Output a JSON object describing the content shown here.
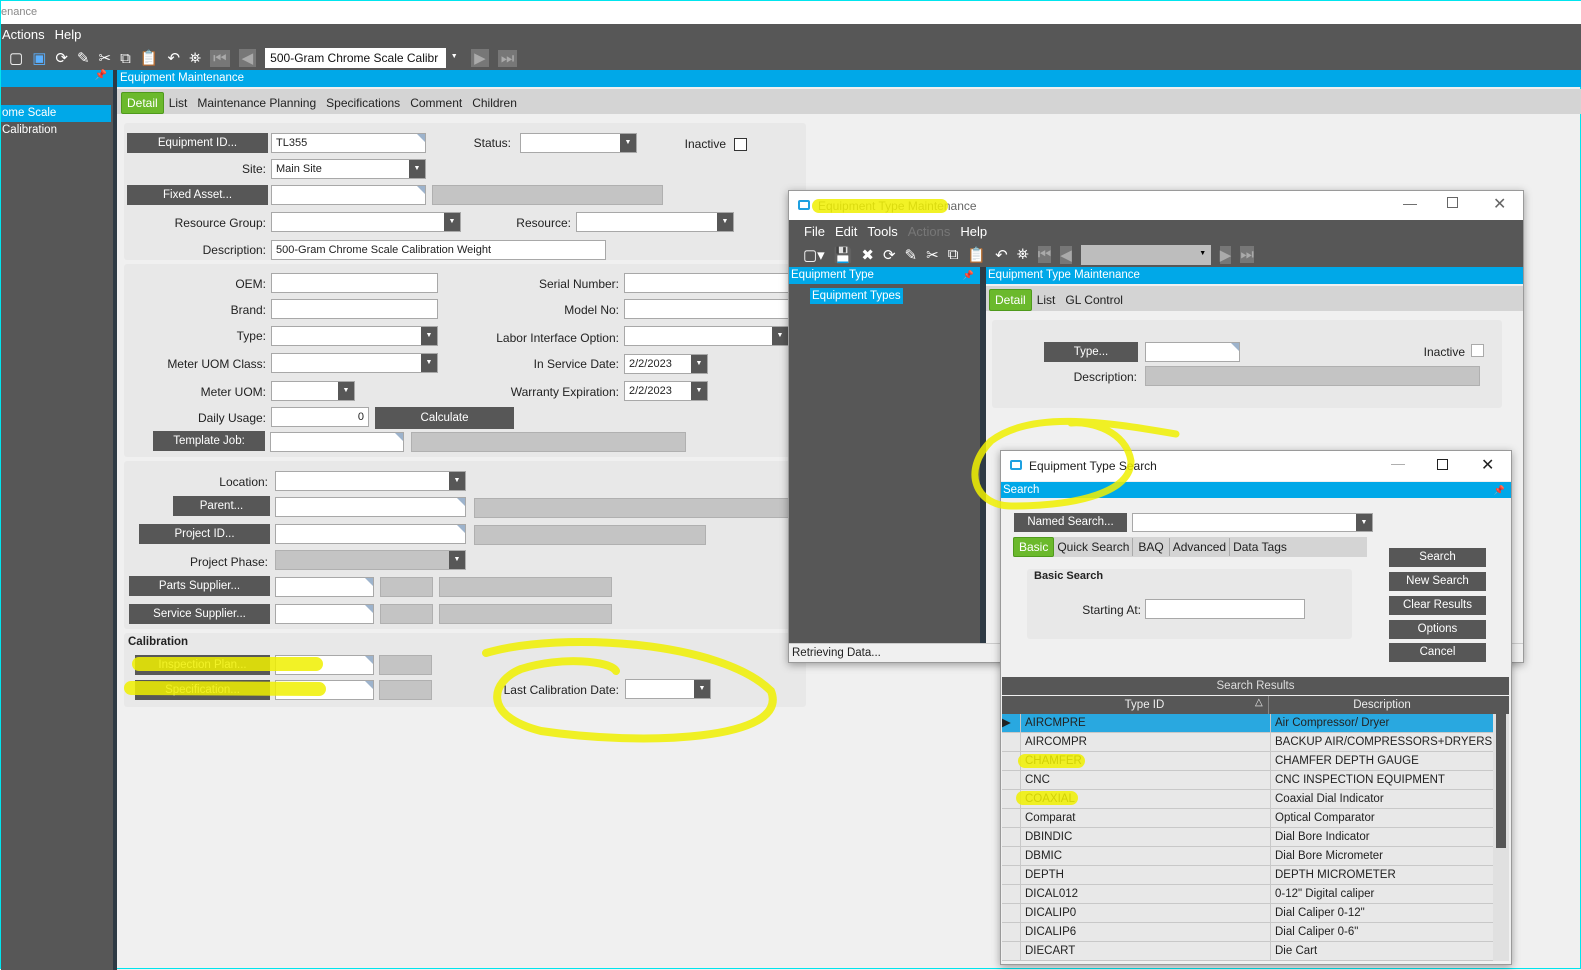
{
  "main": {
    "title": "enance",
    "menu": [
      "Actions",
      "Help"
    ],
    "nav_value": "500-Gram Chrome Scale Calibr",
    "panel_title": "Equipment Maintenance",
    "tree_item": "ome Scale Calibration",
    "tabs": [
      "Detail",
      "List",
      "Maintenance Planning",
      "Specifications",
      "Comment",
      "Children"
    ],
    "form": {
      "equipment_id_btn": "Equipment ID...",
      "equipment_id": "TL355",
      "status_lbl": "Status:",
      "inactive_lbl": "Inactive",
      "site_lbl": "Site:",
      "site": "Main Site",
      "fixed_asset_btn": "Fixed Asset...",
      "resource_group_lbl": "Resource Group:",
      "resource_lbl": "Resource:",
      "description_lbl": "Description:",
      "description": "500-Gram Chrome Scale Calibration Weight",
      "oem_lbl": "OEM:",
      "serial_lbl": "Serial Number:",
      "brand_lbl": "Brand:",
      "model_lbl": "Model No:",
      "type_lbl": "Type:",
      "labor_lbl": "Labor Interface Option:",
      "meter_uom_class_lbl": "Meter UOM Class:",
      "in_service_lbl": "In Service Date:",
      "in_service": "2/2/2023",
      "meter_uom_lbl": "Meter UOM:",
      "warranty_lbl": "Warranty Expiration:",
      "warranty": "2/2/2023",
      "daily_usage_lbl": "Daily Usage:",
      "daily_usage": "0",
      "calculate_btn": "Calculate",
      "template_job_btn": "Template Job:",
      "location_lbl": "Location:",
      "parent_btn": "Parent...",
      "project_id_btn": "Project ID...",
      "project_phase_lbl": "Project Phase:",
      "parts_supplier_btn": "Parts Supplier...",
      "service_supplier_btn": "Service Supplier...",
      "calibration_hdr": "Calibration",
      "inspection_plan_btn": "Inspection Plan...",
      "specification_btn": "Specification...",
      "last_cal_lbl": "Last Calibration Date:"
    }
  },
  "type_maint": {
    "title": "Equipment Type Maintenance",
    "menu": [
      "File",
      "Edit",
      "Tools",
      "Actions",
      "Help"
    ],
    "tree_title": "Equipment Type",
    "tree_item": "Equipment Types",
    "panel_title": "Equipment Type Maintenance",
    "tabs": [
      "Detail",
      "List",
      "GL Control"
    ],
    "type_btn": "Type...",
    "inactive_lbl": "Inactive",
    "description_lbl": "Description:",
    "status": "Retrieving Data..."
  },
  "search": {
    "title": "Equipment Type Search",
    "bar": "Search",
    "named_search_btn": "Named Search...",
    "tabs": [
      "Basic",
      "Quick Search",
      "BAQ",
      "Advanced",
      "Data Tags"
    ],
    "basic_hdr": "Basic Search",
    "starting_at_lbl": "Starting At:",
    "buttons": [
      "Search",
      "New Search",
      "Clear Results",
      "Options",
      "Cancel"
    ],
    "results_title": "Search Results",
    "columns": [
      "Type ID",
      "Description"
    ],
    "rows": [
      [
        "AIRCMPRE",
        "Air Compressor/ Dryer"
      ],
      [
        "AIRCOMPR",
        "BACKUP AIR/COMPRESSORS+DRYERS"
      ],
      [
        "CHAMFER",
        "CHAMFER DEPTH GAUGE"
      ],
      [
        "CNC",
        "CNC INSPECTION EQUIPMENT"
      ],
      [
        "COAXIAL",
        "Coaxial Dial Indicator"
      ],
      [
        "Comparat",
        "Optical Comparator"
      ],
      [
        "DBINDIC",
        "Dial Bore Indicator"
      ],
      [
        "DBMIC",
        "Dial Bore Micrometer"
      ],
      [
        "DEPTH",
        "DEPTH MICROMETER"
      ],
      [
        "DICAL012",
        "0-12\" Digital caliper"
      ],
      [
        "DICALIP0",
        "Dial Caliper 0-12\""
      ],
      [
        "DICALIP6",
        "Dial Caliper 0-6\""
      ],
      [
        "DIECART",
        "Die Cart"
      ]
    ]
  },
  "colors": {
    "accent": "#00a8e8",
    "tab_active": "#6bb92c",
    "chrome": "#575757",
    "highlight": "#f0f000"
  }
}
